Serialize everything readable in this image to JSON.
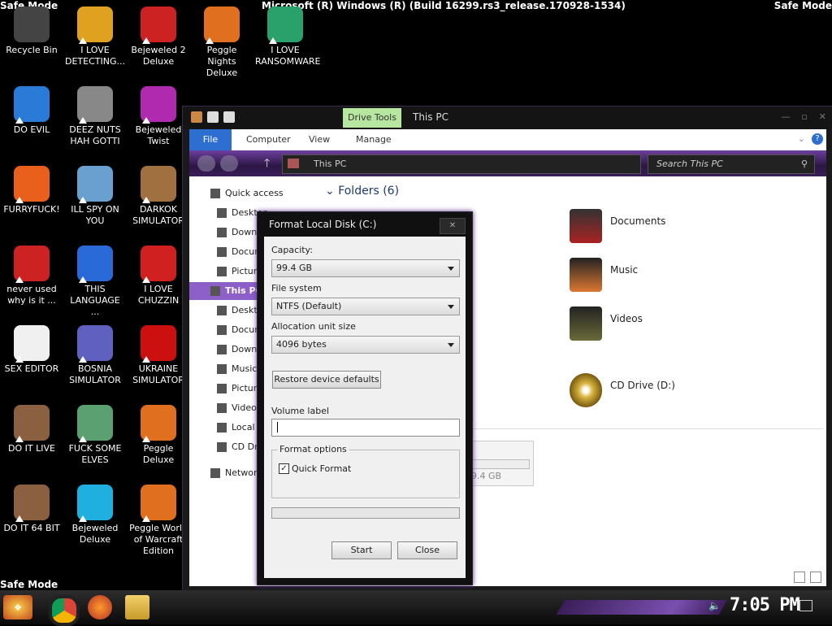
{
  "top_bar": {
    "safe_mode_left": "Safe Mode",
    "safe_mode_right": "Safe Mode",
    "build_text": "Microsoft (R) Windows (R) (Build 16299.rs3_release.170928-1534)"
  },
  "bottom_safe_mode": "Safe Mode",
  "desktop_icons": [
    {
      "label": "Recycle Bin",
      "icon": "recycle-bin-icon",
      "color": "#444444"
    },
    {
      "label": "I LOVE DETECTING...",
      "icon": "detect-it-easy-icon",
      "color": "#e0a020"
    },
    {
      "label": "Bejeweled 2 Deluxe",
      "icon": "bejeweled-icon",
      "color": "#cc2222"
    },
    {
      "label": "Peggle Nights Deluxe",
      "icon": "peggle-icon",
      "color": "#e07020"
    },
    {
      "label": "I LOVE RANSOMWARE",
      "icon": "publisher-icon",
      "color": "#2aa06a"
    },
    {
      "label": "DO EVIL",
      "icon": "chrome-icon",
      "color": "#2a7ad8"
    },
    {
      "label": "DEEZ NUTS HAH GOTTI",
      "icon": "copy-icon",
      "color": "#888888"
    },
    {
      "label": "Bejeweled Twist",
      "icon": "bejeweled-twist-icon",
      "color": "#b02ab0"
    },
    {
      "label": "FURRYFUCK!",
      "icon": "firefox-icon",
      "color": "#e8601c"
    },
    {
      "label": "ILL SPY ON YOU",
      "icon": "spy-tool-icon",
      "color": "#6aa0d0"
    },
    {
      "label": "DARKOK SIMULATOR",
      "icon": "money-bag-icon",
      "color": "#a07040"
    },
    {
      "label": "never used why is it ...",
      "icon": "dev-cpp-icon",
      "color": "#cc2222"
    },
    {
      "label": "THIS LANGUAGE ...",
      "icon": "goland-icon",
      "color": "#2a6ad8"
    },
    {
      "label": "I LOVE CHUZZIN",
      "icon": "chuzzle-icon",
      "color": "#d02020"
    },
    {
      "label": "SEX EDITOR",
      "icon": "hxd-icon",
      "color": "#f0f0f0"
    },
    {
      "label": "BOSNIA SIMULATOR",
      "icon": "mine-icon",
      "color": "#6060c0"
    },
    {
      "label": "UKRAINE SIMULATOR",
      "icon": "radiation-icon",
      "color": "#cc1010"
    },
    {
      "label": "DO IT LIVE",
      "icon": "portrait-icon",
      "color": "#8a6040"
    },
    {
      "label": "FUCK SOME ELVES",
      "icon": "santa-icon",
      "color": "#5aa070"
    },
    {
      "label": "Peggle Deluxe",
      "icon": "peggle-deluxe-icon",
      "color": "#e07020"
    },
    {
      "label": "DO IT 64 BIT",
      "icon": "portrait-64-icon",
      "color": "#8a6040"
    },
    {
      "label": "Bejeweled Deluxe",
      "icon": "diamond-icon",
      "color": "#20b0e0"
    },
    {
      "label": "Peggle World of Warcraft Edition",
      "icon": "peggle-wow-icon",
      "color": "#e07020"
    }
  ],
  "explorer": {
    "title": "This PC",
    "drive_tools": "Drive Tools",
    "ribbon_tabs": [
      "File",
      "Computer",
      "View",
      "Manage"
    ],
    "address": "This PC",
    "search_placeholder": "Search This PC",
    "nav": {
      "quick_access": "Quick access",
      "quick_items": [
        "Desktop",
        "Downloads",
        "Documents",
        "Pictures"
      ],
      "this_pc": "This PC",
      "pc_items": [
        "Desktop",
        "Documents",
        "Downloads",
        "Music",
        "Pictures",
        "Videos",
        "Local Disk (C:)",
        "CD Drive (D:)"
      ],
      "network": "Network"
    },
    "folders_header": "Folders (6)",
    "folders": [
      "Documents",
      "Music",
      "Videos"
    ],
    "drive_c_free": "9.4 GB",
    "cd_drive": "CD Drive (D:)"
  },
  "format_dialog": {
    "title": "Format Local Disk (C:)",
    "close_glyph": "✕",
    "capacity_label": "Capacity:",
    "capacity_value": "99.4 GB",
    "filesystem_label": "File system",
    "filesystem_value": "NTFS (Default)",
    "alloc_label": "Allocation unit size",
    "alloc_value": "4096 bytes",
    "restore_button": "Restore device defaults",
    "volume_label": "Volume label",
    "volume_value": "",
    "format_options": "Format options",
    "quick_format": "Quick Format",
    "quick_format_checked": true,
    "start_button": "Start",
    "close_button": "Close"
  },
  "taskbar": {
    "clock": "7:05 PM",
    "start_icon": "start-orb-icon",
    "pinned": [
      "chrome-icon",
      "firefox-icon",
      "explorer-icon"
    ]
  }
}
